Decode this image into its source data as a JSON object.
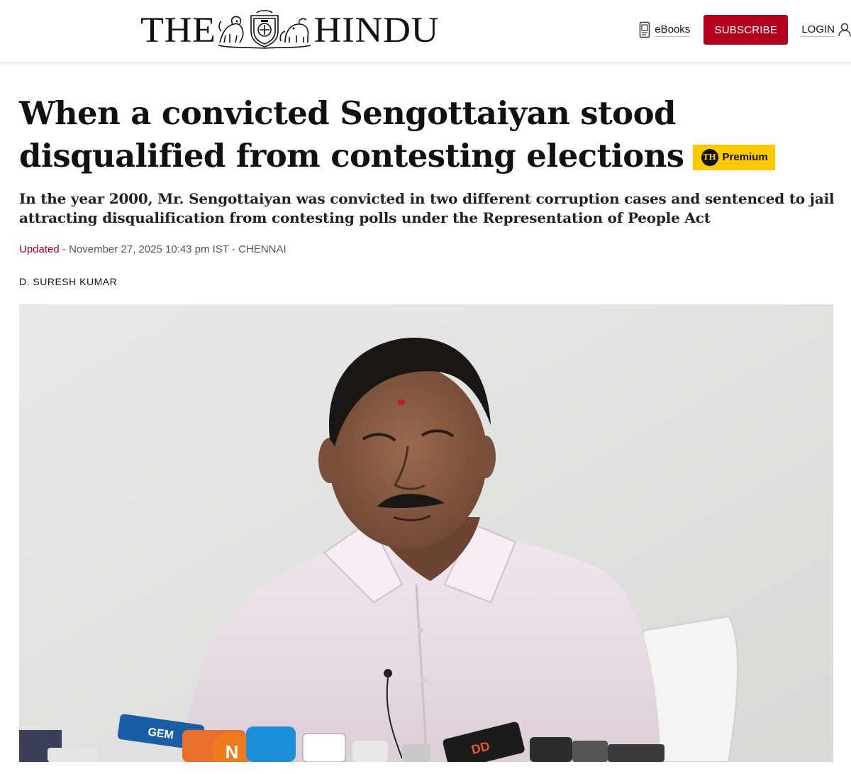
{
  "header": {
    "masthead_left": "THE",
    "masthead_right": "HINDU",
    "ebooks_label": "eBooks",
    "subscribe_label": "SUBSCRIBE",
    "login_label": "LOGIN",
    "brand_color": "#b3001e"
  },
  "article": {
    "headline": "When a convicted Sengottaiyan stood disqualified from contesting elections",
    "premium_badge": {
      "logo_text": "TH",
      "label": "Premium",
      "color": "#ffc906"
    },
    "standfirst": "In the year 2000, Mr. Sengottaiyan was convicted in two different corruption cases and sentenced to jail attracting disqualification from contesting polls under the Representation of People Act",
    "dateline": {
      "status": "Updated",
      "separator": " - ",
      "datetime": "November 27, 2025 10:43 pm IST",
      "location": "CHENNAI"
    },
    "byline": "D. SURESH KUMAR"
  },
  "photo": {
    "microphone_labels": [
      "GEM",
      "N",
      "DD"
    ]
  },
  "icons": [
    "masthead-emblem",
    "book-icon",
    "user-icon",
    "th-logo"
  ]
}
